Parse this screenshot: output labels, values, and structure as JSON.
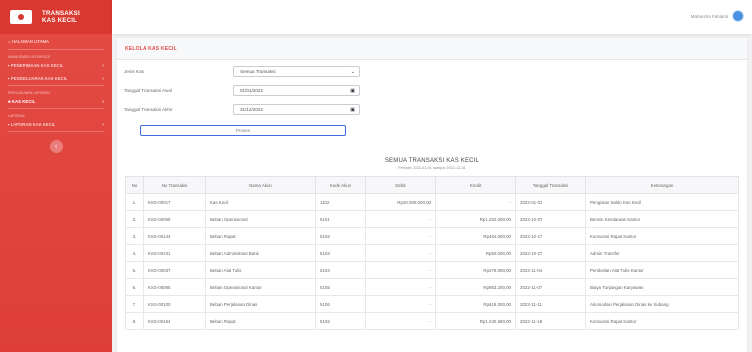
{
  "brand": {
    "line1": "TRANSAKSI",
    "line2": "KAS KECIL"
  },
  "sidebar": {
    "home": "HALAMAN UTAMA",
    "heading1": "MANAJEMEN INTERFACE",
    "penerimaan": "PENERIMAAN KAS KECIL",
    "pengeluaran": "PENGELUARAN KAS KECIL",
    "heading2": "PENYUSUNAN LAPORAN",
    "kaskecil": "KAS KECIL",
    "heading3": "LAPORAN",
    "laporan": "LAPORAN KAS KECIL",
    "toggle": "‹"
  },
  "topbar": {
    "user": "Maharsha Febianti"
  },
  "card": {
    "title": "KELOLA KAS KECIL"
  },
  "form": {
    "jenis_label": "Jenis Kas",
    "jenis_value": "Semua Transaksi",
    "awal_label": "Tanggal Transaksi Awal",
    "awal_value": "01/01/2022",
    "akhir_label": "Tanggal Transaksi Akhir",
    "akhir_value": "31/12/2022",
    "proses": "Proses"
  },
  "report": {
    "title": "SEMUA TRANSAKSI KAS KECIL",
    "period": "Periode 2022-01-01 sampai 2022-12-31"
  },
  "table": {
    "headers": [
      "No",
      "No Transaksi",
      "Nama Akun",
      "Kode Akun",
      "Debit",
      "Kredit",
      "Tanggal Transaksi",
      "Keterangan"
    ],
    "rows": [
      [
        "1.",
        "KSS-00017",
        "Kas Kecil",
        "1102",
        "Rp20.000.000,00",
        "-",
        "2022-01-01",
        "Pengisian Saldo Kas Kecil"
      ],
      [
        "2.",
        "KSS-00059",
        "Beban Operasional",
        "5101",
        "-",
        "Rp1.262.000,00",
        "2022-10-07",
        "Bensin Kendaraan Kantor"
      ],
      [
        "3.",
        "KSS-00144",
        "Beban Rapat",
        "5102",
        "-",
        "Rp464.000,00",
        "2022-10-17",
        "Konsumsi Rapat Kantor"
      ],
      [
        "4.",
        "KSS-00231",
        "Beban Administrasi Bank",
        "5103",
        "-",
        "Rp60.000,00",
        "2022-10-27",
        "Admin Transfer"
      ],
      [
        "5.",
        "KSS-00037",
        "Beban Alat Tulis",
        "5104",
        "-",
        "Rp478.000,00",
        "2022-11-04",
        "Pembelian Alat Tulis Kantor"
      ],
      [
        "6.",
        "KSS-00065",
        "Beban Operasional Kantor",
        "5105",
        "-",
        "Rp953.200,00",
        "2022-11-07",
        "Biaya Tunjangan Karyawan"
      ],
      [
        "7.",
        "KSS-00100",
        "Beban Perjalanan Dinas",
        "5106",
        "-",
        "Rp619.200,00",
        "2022-11-11",
        "Akomodasi Perjalanan Dinas ke Subang"
      ],
      [
        "8.",
        "KSS-00164",
        "Beban Rapat",
        "5102",
        "-",
        "Rp1.040.580,00",
        "2022-11-18",
        "Konsumsi Rapat Kantor"
      ]
    ]
  }
}
